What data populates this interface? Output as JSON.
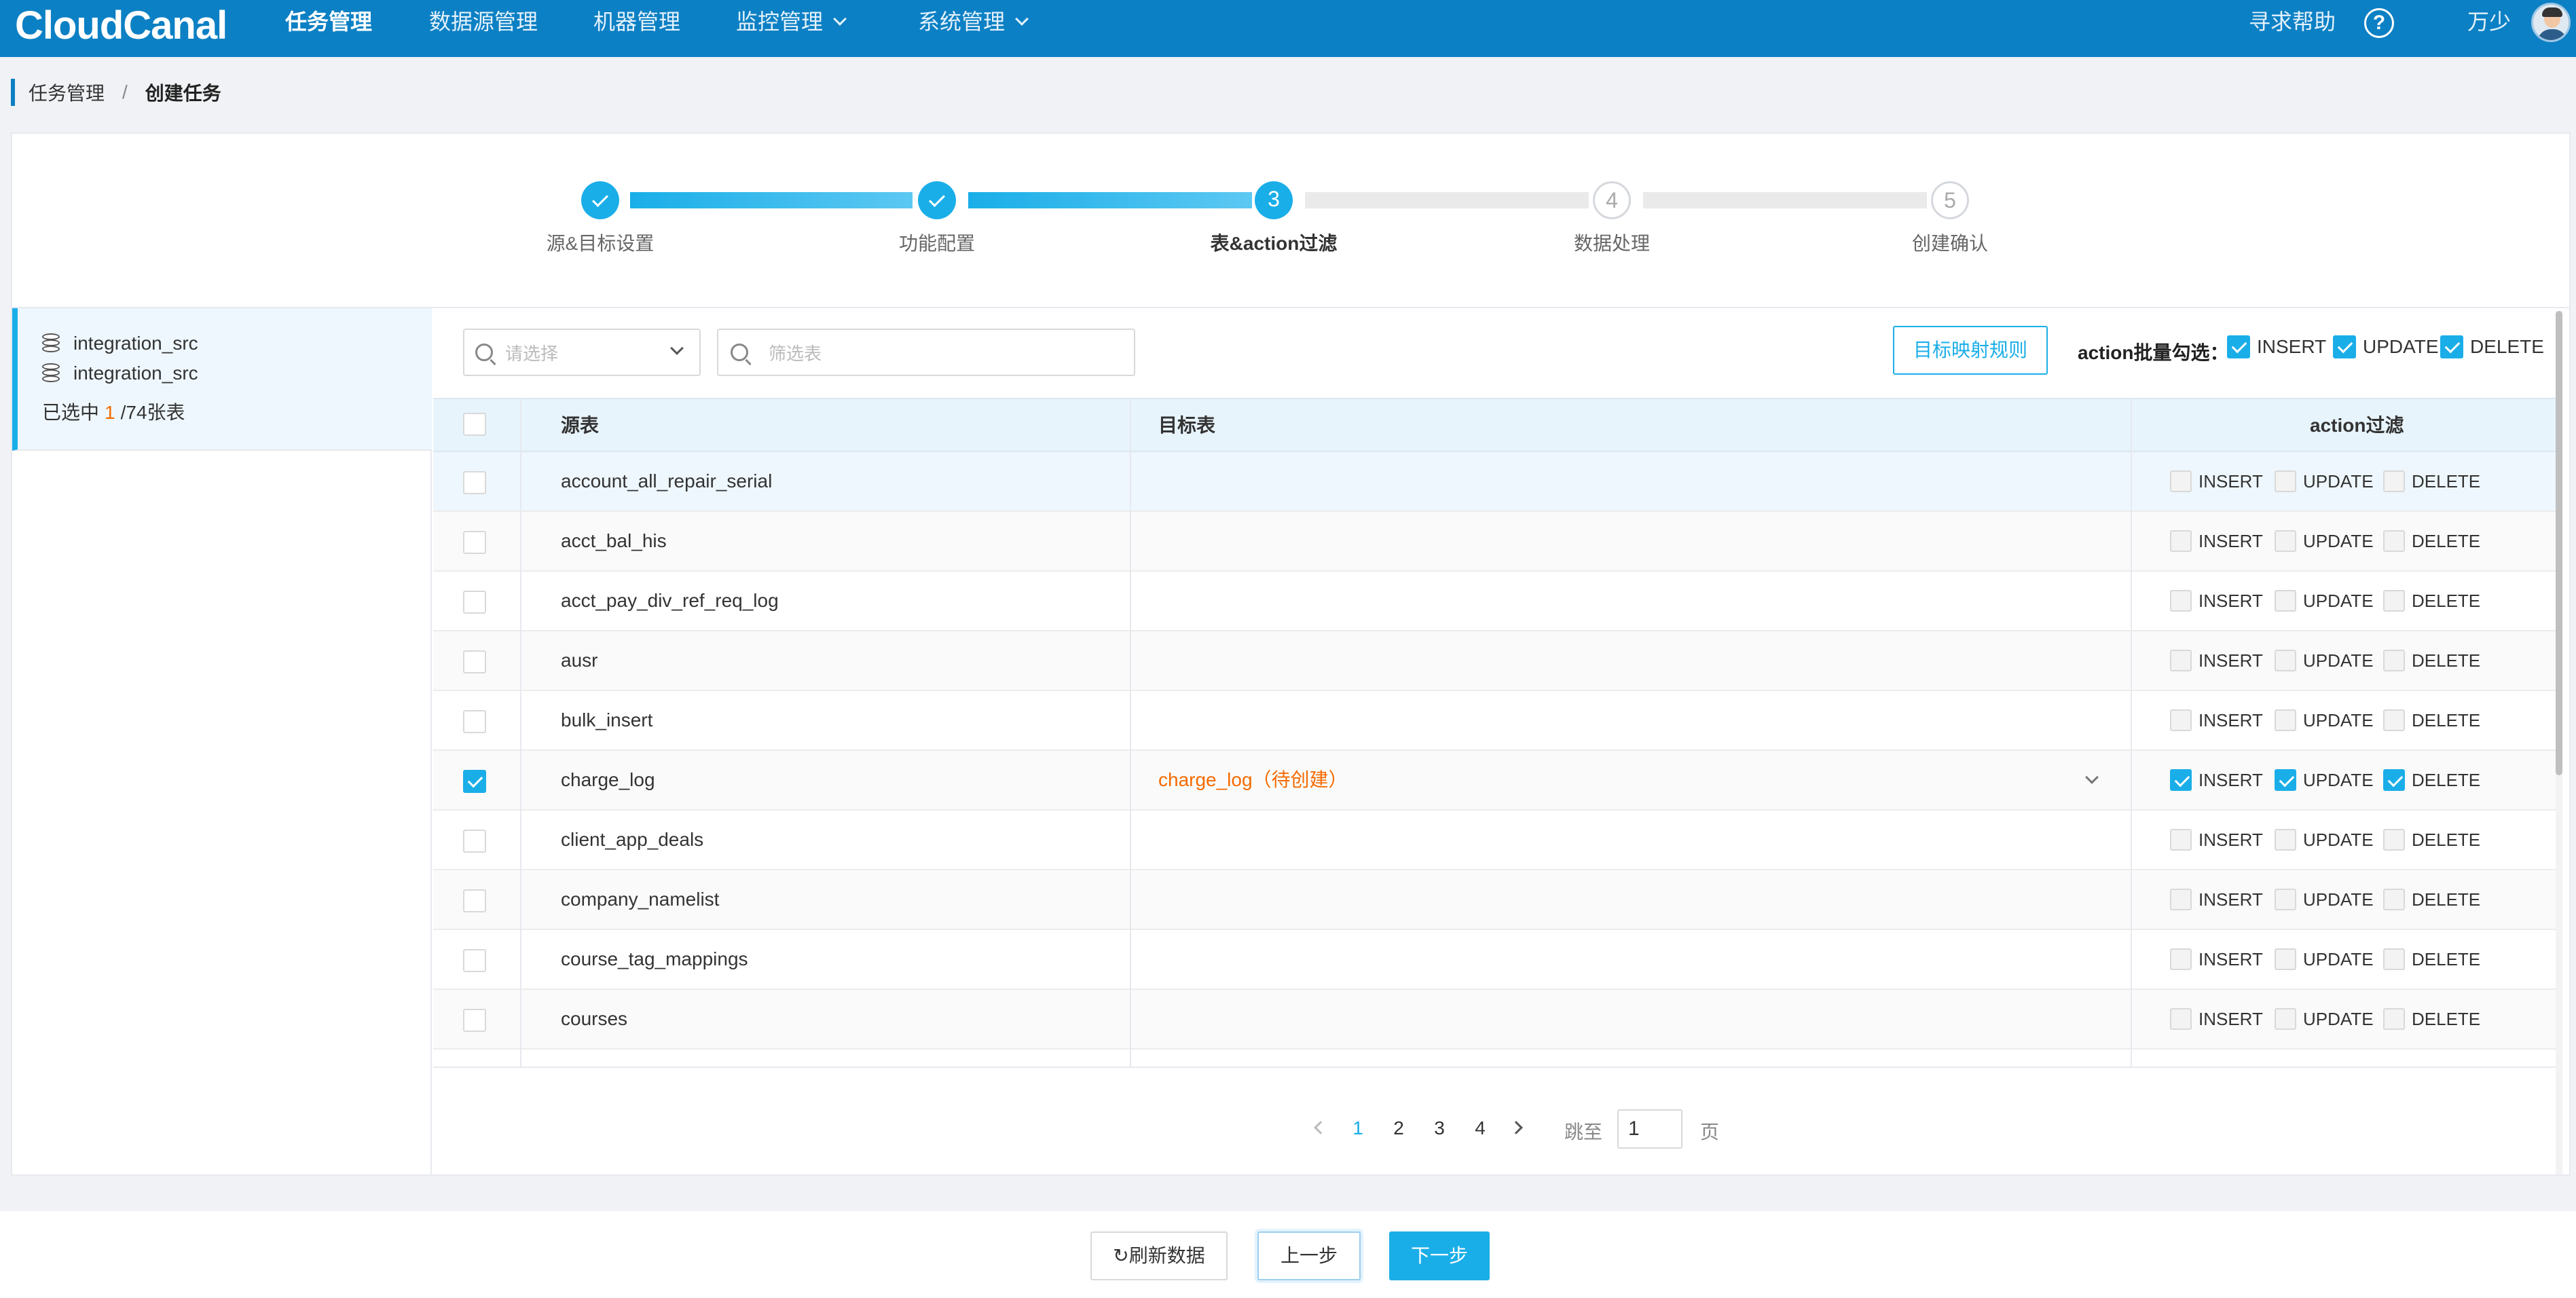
{
  "app": {
    "logo": "CloudCanal",
    "nav": [
      "任务管理",
      "数据源管理",
      "机器管理",
      "监控管理",
      "系统管理"
    ],
    "help": "寻求帮助",
    "help_icon": "?",
    "user": "万少"
  },
  "breadcrumb": [
    "任务管理",
    "创建任务"
  ],
  "breadcrumb_sep": "/",
  "steps": [
    {
      "num": "1",
      "label": "源&目标设置",
      "state": "done"
    },
    {
      "num": "2",
      "label": "功能配置",
      "state": "done"
    },
    {
      "num": "3",
      "label": "表&action过滤",
      "state": "active"
    },
    {
      "num": "4",
      "label": "数据处理",
      "state": "todo"
    },
    {
      "num": "5",
      "label": "创建确认",
      "state": "todo"
    }
  ],
  "left": {
    "source_db": "integration_src",
    "target_db": "integration_src",
    "selected_prefix": "已选中",
    "selected_count": "1",
    "selected_suffix": "/74张表"
  },
  "toolbar": {
    "select_placeholder": "请选择",
    "search_placeholder": "筛选表",
    "mapping_button": "目标映射规则",
    "batch_label": "action批量勾选：",
    "batch_options": [
      "INSERT",
      "UPDATE",
      "DELETE"
    ]
  },
  "table": {
    "headers": {
      "source": "源表",
      "target": "目标表",
      "action": "action过滤"
    },
    "action_labels": [
      "INSERT",
      "UPDATE",
      "DELETE"
    ],
    "rows": [
      {
        "source": "account_all_repair_serial",
        "target": "",
        "checked": false
      },
      {
        "source": "acct_bal_his",
        "target": "",
        "checked": false
      },
      {
        "source": "acct_pay_div_ref_req_log",
        "target": "",
        "checked": false
      },
      {
        "source": "ausr",
        "target": "",
        "checked": false
      },
      {
        "source": "bulk_insert",
        "target": "",
        "checked": false
      },
      {
        "source": "charge_log",
        "target": "charge_log（待创建）",
        "checked": true
      },
      {
        "source": "client_app_deals",
        "target": "",
        "checked": false
      },
      {
        "source": "company_namelist",
        "target": "",
        "checked": false
      },
      {
        "source": "course_tag_mappings",
        "target": "",
        "checked": false
      },
      {
        "source": "courses",
        "target": "",
        "checked": false
      }
    ]
  },
  "pagination": {
    "pages": [
      "1",
      "2",
      "3",
      "4"
    ],
    "current": "1",
    "jump_label": "跳至",
    "jump_value": "1",
    "page_unit": "页"
  },
  "footer": {
    "refresh": "刷新数据",
    "refresh_icon": "↻",
    "prev": "上一步",
    "next": "下一步"
  },
  "colors": {
    "nav_bg": "#0c80c4",
    "accent": "#1aaee8",
    "highlight": "#f56a00"
  }
}
